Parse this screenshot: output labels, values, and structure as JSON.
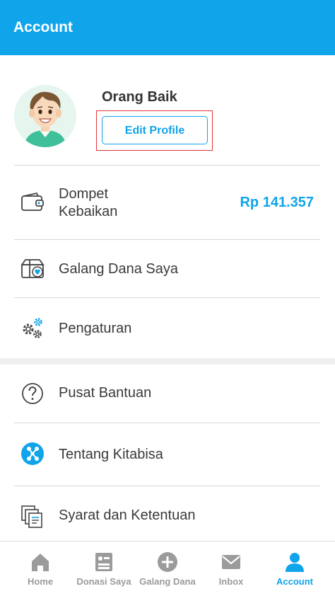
{
  "app_bar": {
    "title": "Account"
  },
  "profile": {
    "name": "Orang Baik",
    "edit_button_label": "Edit Profile",
    "avatar_icon": "person-avatar-icon"
  },
  "menu": {
    "wallet": {
      "label_line1": "Dompet",
      "label_line2": "Kebaikan",
      "value": "Rp 141.357",
      "icon": "wallet-icon"
    },
    "campaigns": {
      "label": "Galang Dana Saya",
      "icon": "campaign-box-icon"
    },
    "settings": {
      "label": "Pengaturan",
      "icon": "gears-icon"
    },
    "help": {
      "label": "Pusat Bantuan",
      "icon": "question-icon"
    },
    "about": {
      "label": "Tentang Kitabisa",
      "icon": "kitabisa-logo-icon"
    },
    "terms": {
      "label": "Syarat dan Ketentuan",
      "icon": "documents-icon"
    }
  },
  "bottom_nav": {
    "items": [
      {
        "label": "Home",
        "icon": "home-icon",
        "active": false
      },
      {
        "label": "Donasi Saya",
        "icon": "donation-list-icon",
        "active": false
      },
      {
        "label": "Galang Dana",
        "icon": "plus-circle-icon",
        "active": false
      },
      {
        "label": "Inbox",
        "icon": "mail-icon",
        "active": false
      },
      {
        "label": "Account",
        "icon": "person-icon",
        "active": true
      }
    ]
  },
  "colors": {
    "brand": "#10a4ea",
    "highlight": "#e0343a",
    "nav_inactive": "#9b9b9b",
    "text": "#3a3a3a"
  }
}
